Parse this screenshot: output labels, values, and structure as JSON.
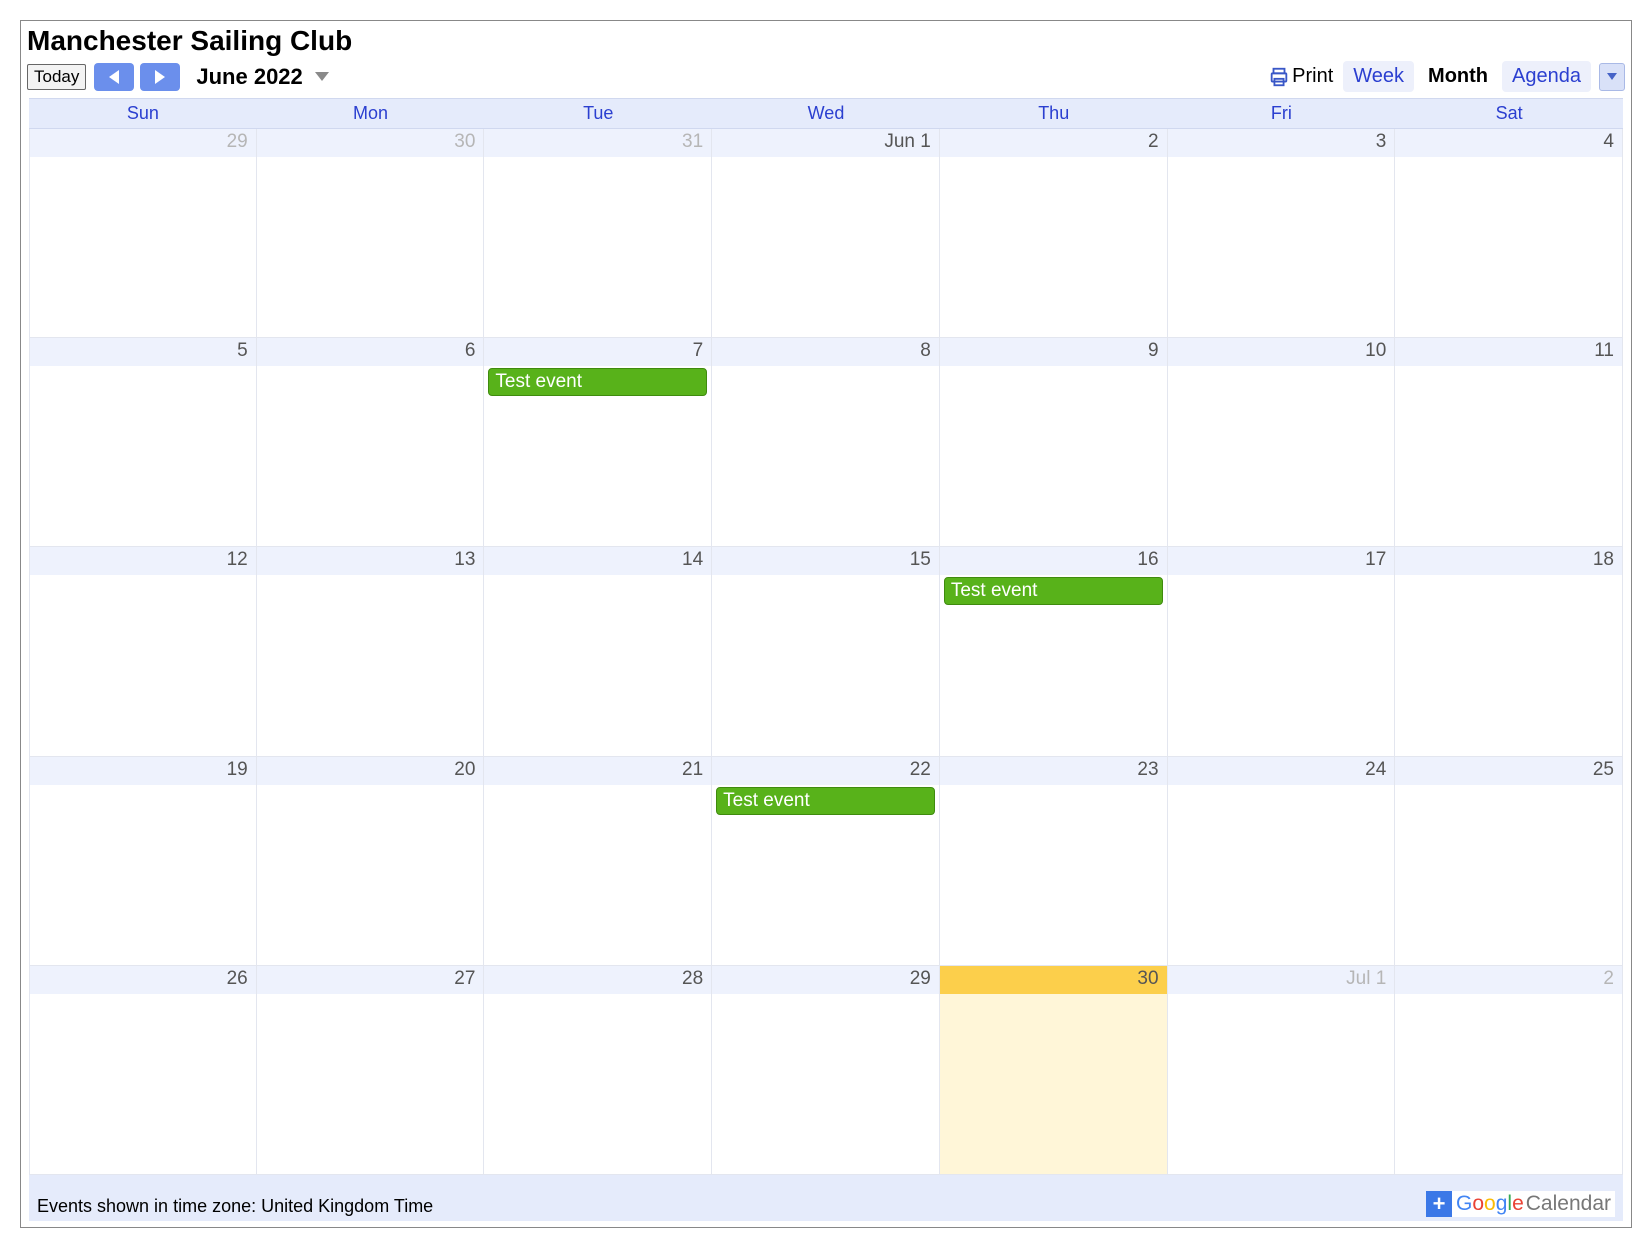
{
  "title": "Manchester Sailing Club",
  "toolbar": {
    "today": "Today",
    "month_label": "June 2022",
    "print": "Print",
    "views": {
      "week": "Week",
      "month": "Month",
      "agenda": "Agenda"
    }
  },
  "dow": [
    "Sun",
    "Mon",
    "Tue",
    "Wed",
    "Thu",
    "Fri",
    "Sat"
  ],
  "cells": [
    {
      "label": "29",
      "out": true,
      "events": []
    },
    {
      "label": "30",
      "out": true,
      "events": []
    },
    {
      "label": "31",
      "out": true,
      "events": []
    },
    {
      "label": "Jun 1",
      "out": false,
      "events": []
    },
    {
      "label": "2",
      "out": false,
      "events": []
    },
    {
      "label": "3",
      "out": false,
      "events": []
    },
    {
      "label": "4",
      "out": false,
      "events": []
    },
    {
      "label": "5",
      "out": false,
      "events": []
    },
    {
      "label": "6",
      "out": false,
      "events": []
    },
    {
      "label": "7",
      "out": false,
      "events": [
        "Test event"
      ]
    },
    {
      "label": "8",
      "out": false,
      "events": []
    },
    {
      "label": "9",
      "out": false,
      "events": []
    },
    {
      "label": "10",
      "out": false,
      "events": []
    },
    {
      "label": "11",
      "out": false,
      "events": []
    },
    {
      "label": "12",
      "out": false,
      "events": []
    },
    {
      "label": "13",
      "out": false,
      "events": []
    },
    {
      "label": "14",
      "out": false,
      "events": []
    },
    {
      "label": "15",
      "out": false,
      "events": []
    },
    {
      "label": "16",
      "out": false,
      "events": [
        "Test event"
      ]
    },
    {
      "label": "17",
      "out": false,
      "events": []
    },
    {
      "label": "18",
      "out": false,
      "events": []
    },
    {
      "label": "19",
      "out": false,
      "events": []
    },
    {
      "label": "20",
      "out": false,
      "events": []
    },
    {
      "label": "21",
      "out": false,
      "events": []
    },
    {
      "label": "22",
      "out": false,
      "events": [
        "Test event"
      ]
    },
    {
      "label": "23",
      "out": false,
      "events": []
    },
    {
      "label": "24",
      "out": false,
      "events": []
    },
    {
      "label": "25",
      "out": false,
      "events": []
    },
    {
      "label": "26",
      "out": false,
      "events": []
    },
    {
      "label": "27",
      "out": false,
      "events": []
    },
    {
      "label": "28",
      "out": false,
      "events": []
    },
    {
      "label": "29",
      "out": false,
      "events": []
    },
    {
      "label": "30",
      "out": false,
      "events": [],
      "today": true
    },
    {
      "label": "Jul 1",
      "out": true,
      "events": []
    },
    {
      "label": "2",
      "out": true,
      "events": []
    }
  ],
  "footer": {
    "tz": "Events shown in time zone: United Kingdom Time",
    "gcal": {
      "google": "Google",
      "calendar": "Calendar"
    }
  }
}
